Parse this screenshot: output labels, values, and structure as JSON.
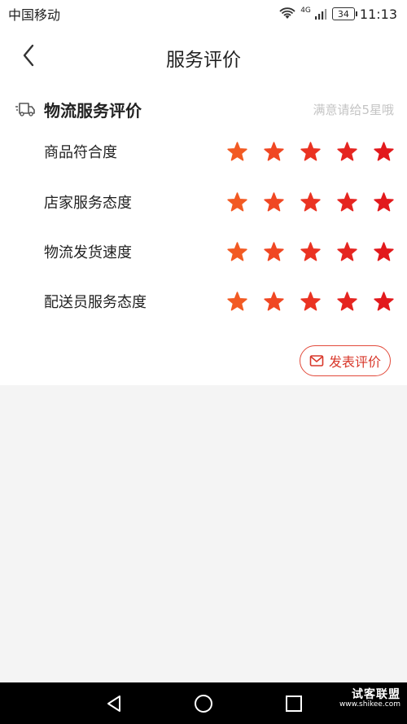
{
  "status_bar": {
    "carrier": "中国移动",
    "network": "4G",
    "battery": "34",
    "time": "11:13"
  },
  "header": {
    "title": "服务评价"
  },
  "section": {
    "title": "物流服务评价",
    "hint": "满意请给5星哦"
  },
  "ratings": [
    {
      "label": "商品符合度",
      "stars": 5
    },
    {
      "label": "店家服务态度",
      "stars": 5
    },
    {
      "label": "物流发货速度",
      "stars": 5
    },
    {
      "label": "配送员服务态度",
      "stars": 5
    }
  ],
  "submit": {
    "label": "发表评价"
  },
  "watermark": {
    "main": "试客联盟",
    "sub": "www.shikee.com"
  },
  "colors": {
    "accent": "#d8372a",
    "star_gradient": [
      "#f25a23",
      "#f04723",
      "#ea3322",
      "#e52520",
      "#e2191c"
    ],
    "hint": "#c4c4c4"
  },
  "icons": {
    "back": "chevron-left-icon",
    "truck": "truck-icon",
    "star": "star-icon",
    "edit": "mail-edit-icon"
  }
}
